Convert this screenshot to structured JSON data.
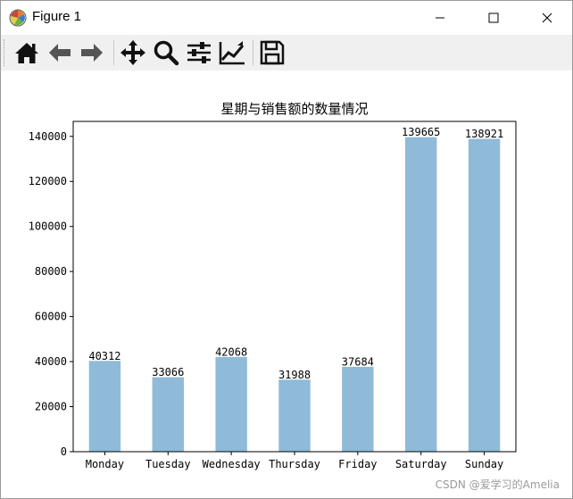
{
  "window": {
    "title": "Figure 1"
  },
  "toolbar": {
    "buttons": [
      {
        "icon": "home-icon"
      },
      {
        "icon": "back-arrow-icon"
      },
      {
        "icon": "forward-arrow-icon"
      },
      {
        "icon": "pan-move-icon"
      },
      {
        "icon": "zoom-magnifier-icon"
      },
      {
        "icon": "configure-subplots-icon"
      },
      {
        "icon": "edit-axis-curves-icon"
      },
      {
        "icon": "save-disk-icon"
      }
    ]
  },
  "chart_data": {
    "type": "bar",
    "title": "星期与销售额的数量情况",
    "categories": [
      "Monday",
      "Tuesday",
      "Wednesday",
      "Thursday",
      "Friday",
      "Saturday",
      "Sunday"
    ],
    "values": [
      40312,
      33066,
      42068,
      31988,
      37684,
      139665,
      138921
    ],
    "data_labels": [
      "40312",
      "33066",
      "42068",
      "31988",
      "37684",
      "139665",
      "138921"
    ],
    "yticks": [
      0,
      20000,
      40000,
      60000,
      80000,
      100000,
      120000,
      140000
    ],
    "ylim": [
      0,
      146648
    ],
    "bar_color": "#8fbbd9",
    "grid": false,
    "xlabel": "",
    "ylabel": ""
  },
  "watermark": "CSDN @爱学习的Amelia"
}
